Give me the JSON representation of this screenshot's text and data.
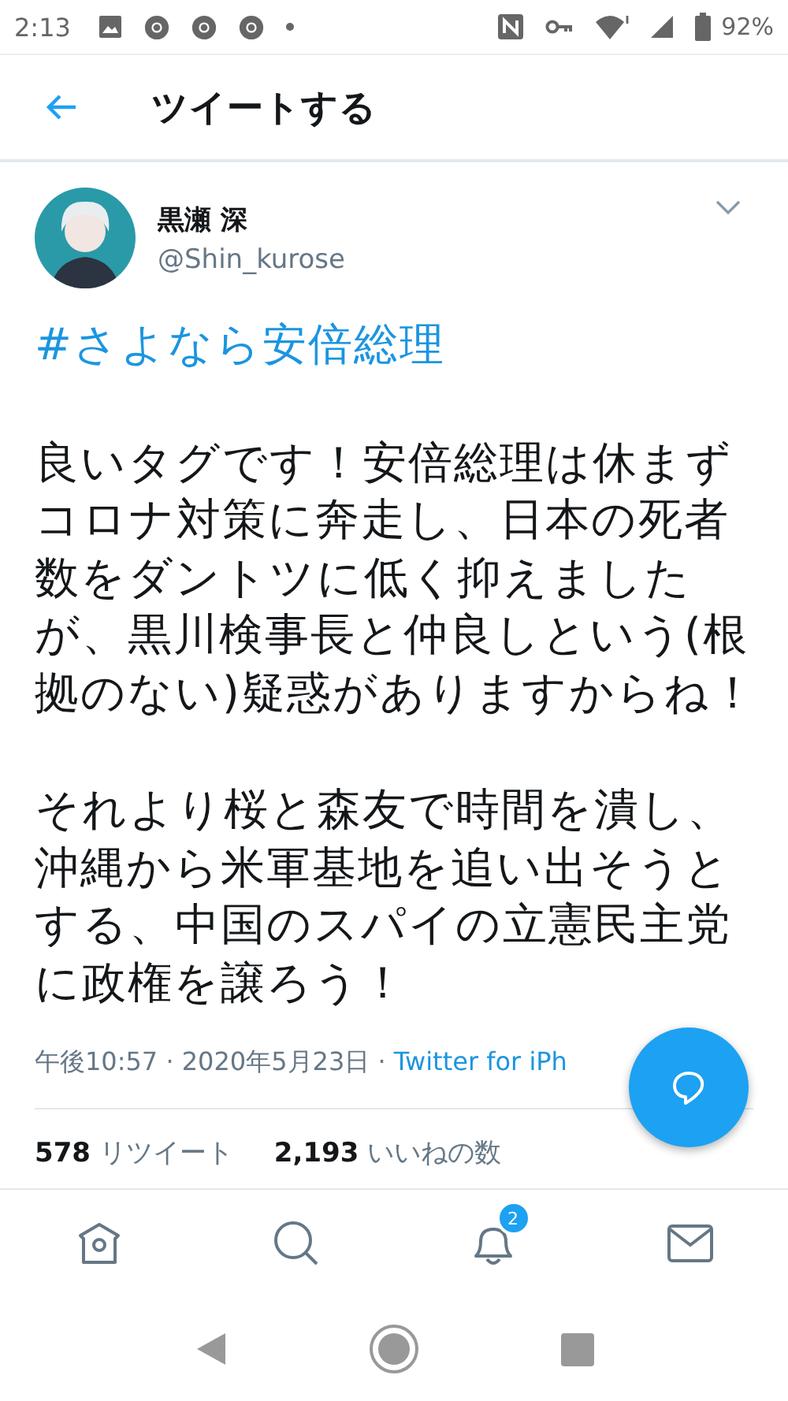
{
  "status_bar": {
    "time": "2:13",
    "battery": "92%"
  },
  "header": {
    "title": "ツイートする"
  },
  "tweet": {
    "display_name": "黒瀬 深",
    "handle": "@Shin_kurose",
    "hashtag": "#さよなら安倍総理",
    "paragraphs": [
      "良いタグです！安倍総理は休まずコロナ対策に奔走し、日本の死者数をダントツに低く抑えましたが、黒川検事長と仲良しという(根拠のない)疑惑がありますからね！",
      "それより桜と森友で時間を潰し、沖縄から米軍基地を追い出そうとする、中国のスパイの立憲民主党に政権を譲ろう！"
    ],
    "time": "午後10:57 · 2020年5月23日 · ",
    "source": "Twitter for iPh",
    "stats": [
      {
        "count": "578",
        "label": "リツイート"
      },
      {
        "count": "2,193",
        "label": "いいねの数"
      }
    ]
  },
  "bottom_nav": {
    "notification_badge": "2"
  }
}
